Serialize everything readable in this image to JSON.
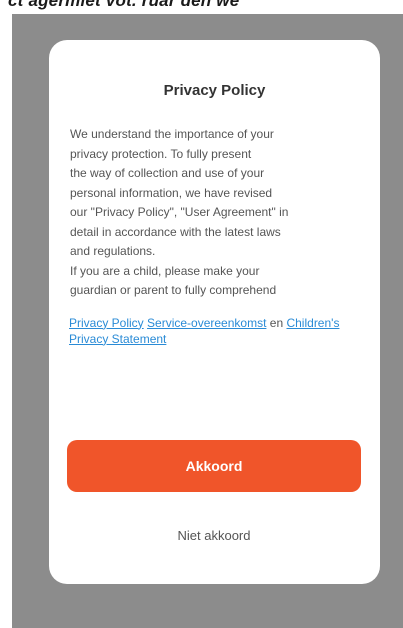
{
  "top_text": "ct agermiet vot. ruar den we",
  "dialog": {
    "title": "Privacy Policy",
    "body": "We understand the importance of your\nprivacy protection. To fully present\nthe way of collection and use of your\npersonal information, we have revised\nour \"Privacy Policy\", \"User Agreement\" in\ndetail in accordance with the latest laws\nand regulations.\nIf you are a child, please make your\nguardian or parent to fully comprehend",
    "links": {
      "privacy_policy": "Privacy Policy",
      "service_agreement": "Service-overeenkomst",
      "connector": "en",
      "children_statement": "Children's Privacy Statement"
    },
    "agree_label": "Akkoord",
    "disagree_label": "Niet akkoord"
  },
  "colors": {
    "accent": "#f0552a",
    "link": "#2a8bd6",
    "overlay": "#8c8c8c"
  }
}
